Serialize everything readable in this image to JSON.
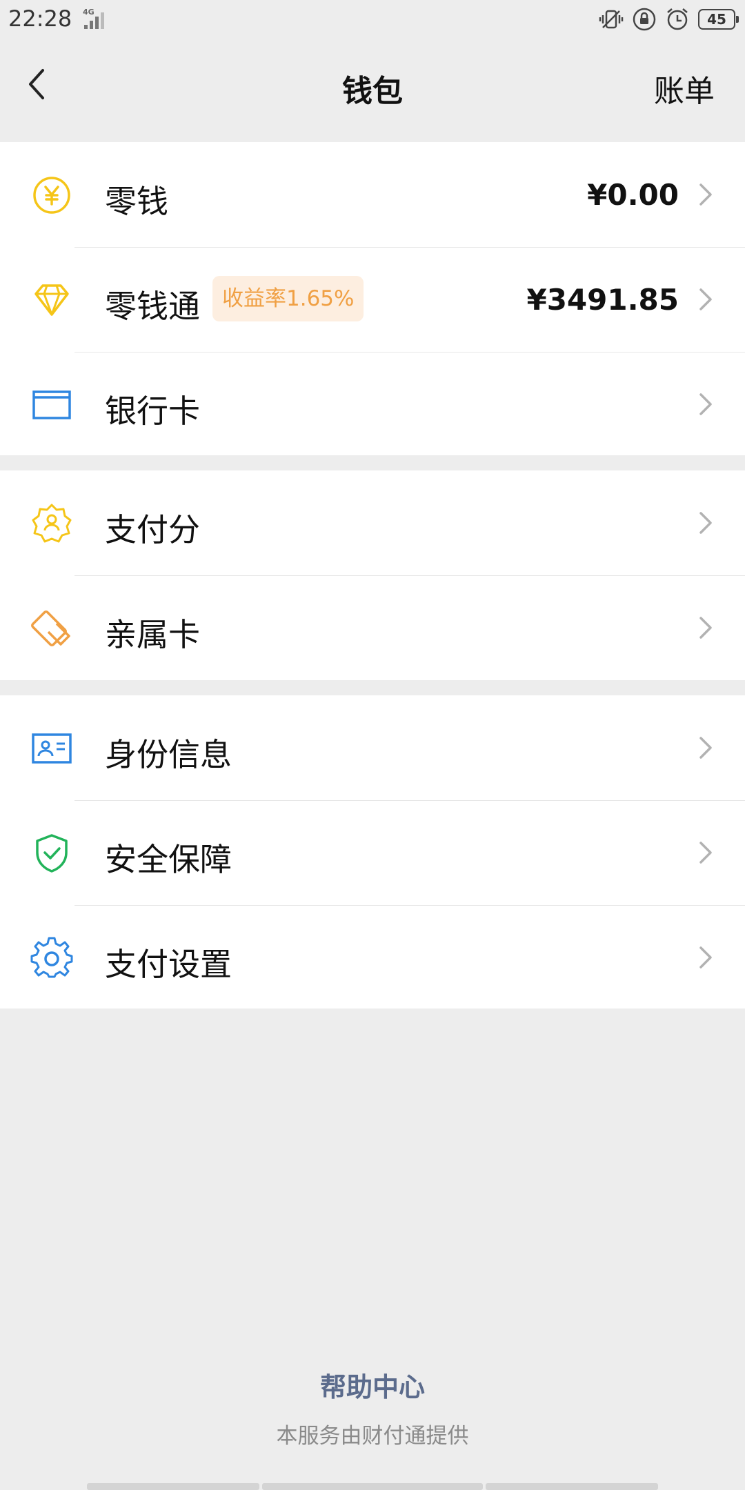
{
  "status_bar": {
    "time": "22:28",
    "network": "4G",
    "battery": "45"
  },
  "nav": {
    "title": "钱包",
    "action": "账单"
  },
  "groups": [
    {
      "items": [
        {
          "label": "零钱",
          "value": "¥0.00",
          "icon": "yuan-coin-icon"
        },
        {
          "label": "零钱通",
          "badge": "收益率1.65%",
          "value": "¥3491.85",
          "icon": "diamond-icon"
        },
        {
          "label": "银行卡",
          "icon": "bank-card-icon"
        }
      ]
    },
    {
      "items": [
        {
          "label": "支付分",
          "icon": "pay-score-badge-icon"
        },
        {
          "label": "亲属卡",
          "icon": "family-card-icon"
        }
      ]
    },
    {
      "items": [
        {
          "label": "身份信息",
          "icon": "id-card-icon"
        },
        {
          "label": "安全保障",
          "icon": "shield-check-icon"
        },
        {
          "label": "支付设置",
          "icon": "gear-icon"
        }
      ]
    }
  ],
  "footer": {
    "help": "帮助中心",
    "note": "本服务由财付通提供"
  },
  "colors": {
    "background": "#ededed",
    "yellow": "#f5c518",
    "orange": "#f0a044",
    "blue": "#2f86e0",
    "green": "#22b35a",
    "link": "#5b6b8c"
  }
}
